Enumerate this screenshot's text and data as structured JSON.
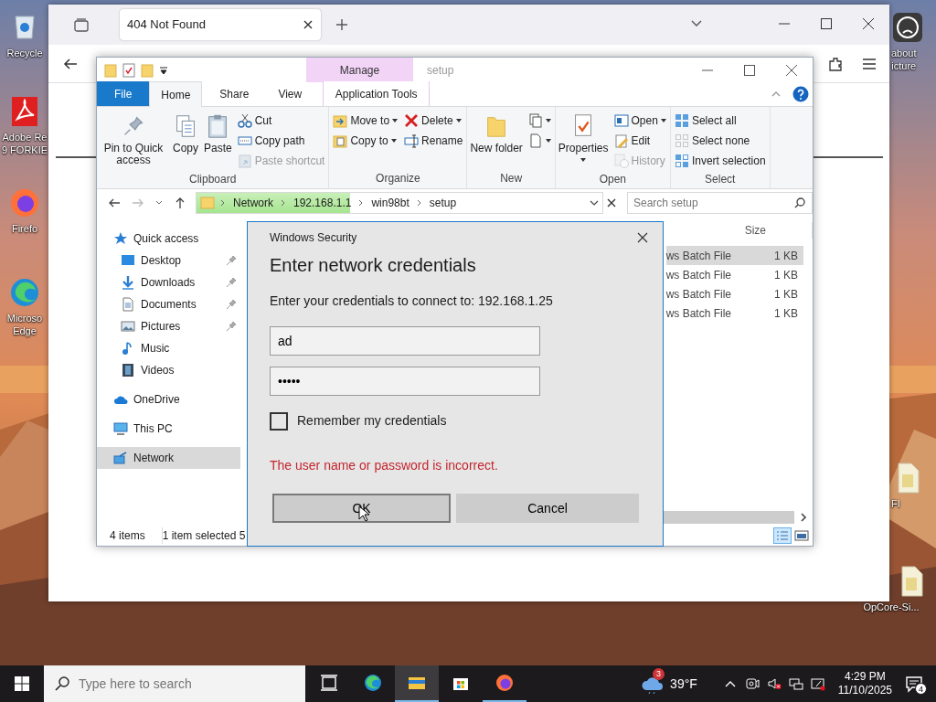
{
  "desktop": {
    "left_icons": [
      {
        "kind": "recycle",
        "lines": [
          "Recycle"
        ]
      },
      {
        "kind": "pdf",
        "lines": [
          "Adobe Re",
          "9 FORKIE"
        ]
      },
      {
        "kind": "firefox",
        "lines": [
          "Firefo"
        ]
      },
      {
        "kind": "edge",
        "lines": [
          "Microso",
          "Edge"
        ]
      }
    ],
    "right_icons": [
      {
        "kind": "sad",
        "lines": [
          "about",
          "icture"
        ]
      },
      {
        "kind": "file",
        "lines": [
          "FI"
        ]
      },
      {
        "kind": "file",
        "lines": [
          "OpCore-Si..."
        ]
      }
    ]
  },
  "browser": {
    "tab_title": "404 Not Found"
  },
  "explorer": {
    "title": "setup",
    "context_tab": "Manage",
    "ribbon_tabs": [
      {
        "label": "File",
        "kind": "file",
        "selected": false
      },
      {
        "label": "Home",
        "kind": "tab",
        "selected": true
      },
      {
        "label": "Share",
        "kind": "tab",
        "selected": false
      },
      {
        "label": "View",
        "kind": "tab",
        "selected": false
      },
      {
        "label": "Application Tools",
        "kind": "context",
        "selected": false
      }
    ],
    "ribbon_groups": [
      {
        "label": "Clipboard",
        "columns": [
          [
            {
              "kind": "large",
              "label": "Pin to Quick access",
              "dropdown": false,
              "disabled": false
            }
          ],
          [
            {
              "kind": "large",
              "label": "Copy",
              "dropdown": false,
              "disabled": false
            }
          ],
          [
            {
              "kind": "large",
              "label": "Paste",
              "dropdown": false,
              "disabled": false
            }
          ],
          [
            {
              "kind": "small",
              "label": "Cut",
              "dropdown": false,
              "disabled": false
            },
            {
              "kind": "small",
              "label": "Copy path",
              "dropdown": false,
              "disabled": false
            },
            {
              "kind": "small",
              "label": "Paste shortcut",
              "dropdown": false,
              "disabled": true
            }
          ]
        ]
      },
      {
        "label": "Organize",
        "columns": [
          [
            {
              "kind": "small",
              "label": "Move to",
              "dropdown": true,
              "disabled": false
            },
            {
              "kind": "small",
              "label": "Copy to",
              "dropdown": true,
              "disabled": false
            }
          ],
          [
            {
              "kind": "small",
              "label": "Delete",
              "dropdown": true,
              "disabled": false
            },
            {
              "kind": "small",
              "label": "Rename",
              "dropdown": false,
              "disabled": false
            }
          ]
        ]
      },
      {
        "label": "New",
        "columns": [
          [
            {
              "kind": "large",
              "label": "New folder",
              "dropdown": false,
              "disabled": false
            }
          ],
          [
            {
              "kind": "icon",
              "dropdown": true,
              "disabled": false
            },
            {
              "kind": "icon",
              "dropdown": true,
              "disabled": false
            }
          ]
        ]
      },
      {
        "label": "Open",
        "columns": [
          [
            {
              "kind": "large",
              "label": "Properties",
              "dropdown": true,
              "disabled": false
            }
          ],
          [
            {
              "kind": "small",
              "label": "Open",
              "dropdown": true,
              "disabled": false
            },
            {
              "kind": "small",
              "label": "Edit",
              "dropdown": false,
              "disabled": false
            },
            {
              "kind": "small",
              "label": "History",
              "dropdown": false,
              "disabled": true
            }
          ]
        ]
      },
      {
        "label": "Select",
        "columns": [
          [
            {
              "kind": "small",
              "label": "Select all",
              "dropdown": false,
              "disabled": false
            },
            {
              "kind": "small",
              "label": "Select none",
              "dropdown": false,
              "disabled": false
            },
            {
              "kind": "small",
              "label": "Invert selection",
              "dropdown": false,
              "disabled": false
            }
          ]
        ]
      }
    ],
    "breadcrumbs": [
      "Network",
      "192.168.1.1",
      "win98bt",
      "setup"
    ],
    "search": {
      "placeholder": "Search setup"
    },
    "nav": [
      {
        "label": "Quick access",
        "kind": "quick",
        "selected": false,
        "children": [
          {
            "label": "Desktop",
            "kind": "desktop",
            "pinned": true
          },
          {
            "label": "Downloads",
            "kind": "downloads",
            "pinned": true
          },
          {
            "label": "Documents",
            "kind": "documents",
            "pinned": true
          },
          {
            "label": "Pictures",
            "kind": "pictures",
            "pinned": true
          },
          {
            "label": "Music",
            "kind": "music",
            "pinned": false
          },
          {
            "label": "Videos",
            "kind": "videos",
            "pinned": false
          }
        ]
      },
      {
        "label": "OneDrive",
        "kind": "cloud",
        "selected": false
      },
      {
        "label": "This PC",
        "kind": "pc",
        "selected": false
      },
      {
        "label": "Network",
        "kind": "network",
        "selected": true
      }
    ],
    "columns": [
      "Size"
    ],
    "rows": [
      {
        "column_1": "ws Batch File",
        "size": "1 KB",
        "selected": true
      },
      {
        "column_1": "ws Batch File",
        "size": "1 KB",
        "selected": false
      },
      {
        "column_1": "ws Batch File",
        "size": "1 KB",
        "selected": false
      },
      {
        "column_1": "ws Batch File",
        "size": "1 KB",
        "selected": false
      }
    ],
    "status": [
      "4 items",
      "1 item selected 5"
    ]
  },
  "dialog": {
    "title": "Windows Security",
    "heading": "Enter network credentials",
    "prompt": "Enter your credentials to connect to: 192.168.1.25",
    "username": "ad",
    "password": "•••••",
    "remember": {
      "label": "Remember my credentials",
      "checked": false
    },
    "error": "The user name or password is incorrect.",
    "buttons": [
      {
        "label": "OK",
        "selected": true
      },
      {
        "label": "Cancel",
        "selected": false
      }
    ]
  },
  "taskbar": {
    "search_placeholder": "Type here to search",
    "apps": [
      {
        "kind": "taskview",
        "running": false,
        "active": false
      },
      {
        "kind": "edge",
        "running": false,
        "active": false
      },
      {
        "kind": "explorer",
        "running": true,
        "active": true
      },
      {
        "kind": "store",
        "running": false,
        "active": false
      },
      {
        "kind": "firefox",
        "running": true,
        "active": false
      }
    ],
    "weather_badge": "3",
    "temperature": "39°F",
    "time": "4:29 PM",
    "date": "11/10/2025",
    "notifications": "4"
  }
}
